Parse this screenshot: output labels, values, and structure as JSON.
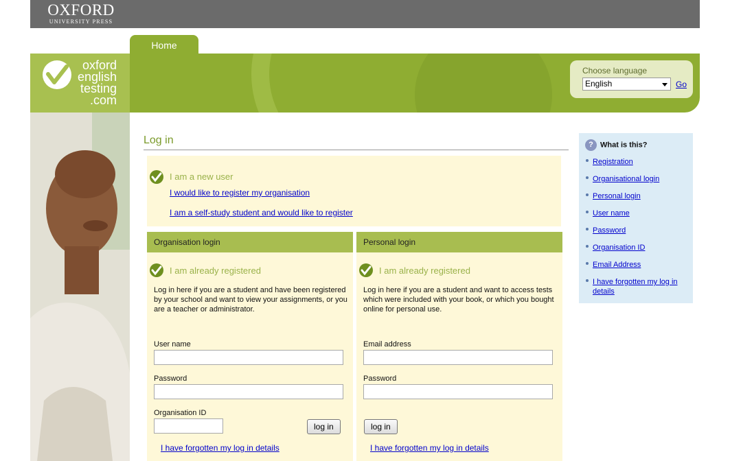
{
  "header": {
    "publisher_name": "OXFORD",
    "publisher_sub": "UNIVERSITY PRESS",
    "nav_tab": "Home",
    "brand_lines": [
      "oxford",
      "english",
      "testing",
      ".com"
    ]
  },
  "language": {
    "label": "Choose language",
    "selected": "English",
    "go_label": "Go"
  },
  "main": {
    "title": "Log in",
    "new_user": {
      "heading": "I am a new user",
      "links": [
        "I would like to register my organisation",
        "I am a self-study student and would like to register"
      ]
    },
    "org_login": {
      "heading": "Organisation login",
      "subheading": "I am already registered",
      "description": "Log in here if you are a student and have been registered by your school and want to view your assignments, or you are a teacher or administrator.",
      "username_label": "User name",
      "password_label": "Password",
      "orgid_label": "Organisation ID",
      "button": "log in",
      "forgot": "I have forgotten my log in details"
    },
    "personal_login": {
      "heading": "Personal login",
      "subheading": "I am already registered",
      "description": "Log in here if you are a student and want to access tests which were included with your book, or which you bought online for personal use.",
      "email_label": "Email address",
      "password_label": "Password",
      "button": "log in",
      "forgot": "I have forgotten my log in details"
    }
  },
  "help": {
    "title": "What is this?",
    "links": [
      "Registration",
      "Organisational login",
      "Personal login",
      "User name",
      "Password",
      "Organisation ID",
      "Email Address",
      "I have forgotten my log in details"
    ]
  },
  "colors": {
    "brand_green": "#8fad32",
    "panel_header": "#a8bd50",
    "panel_bg": "#fef8d8",
    "help_bg": "#dcecf6",
    "link": "#0000cc"
  }
}
